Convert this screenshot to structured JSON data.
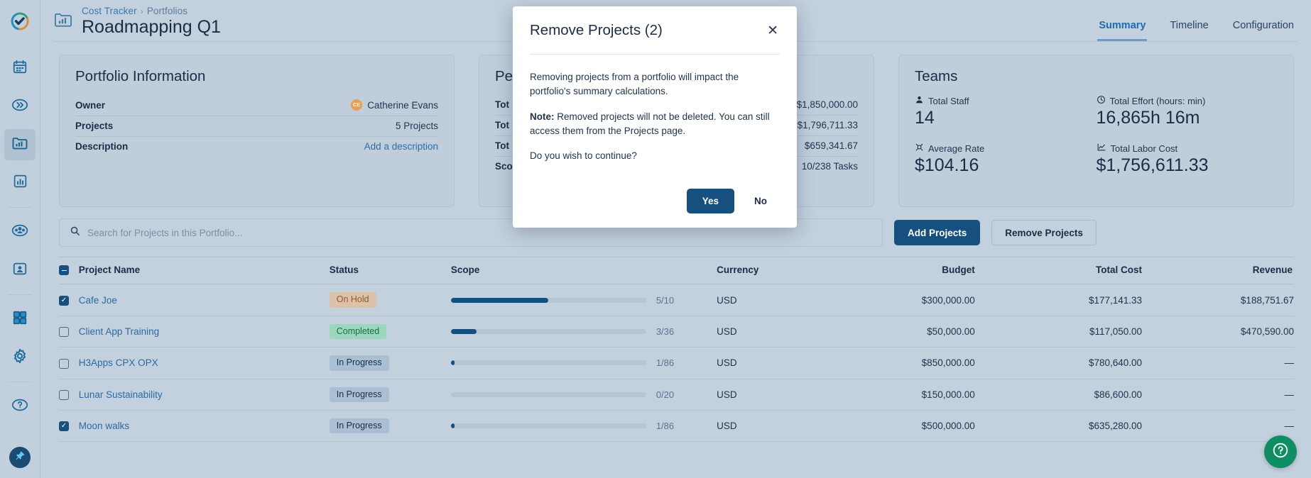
{
  "sidebar": {
    "items": [
      {
        "name": "app-logo-icon",
        "label": "Cost Tracker",
        "active": false
      },
      {
        "name": "calendar-icon",
        "label": "Calendar",
        "active": false
      },
      {
        "name": "chevron-double-right-icon",
        "label": "Timesheets",
        "active": false
      },
      {
        "name": "portfolio-folder-icon",
        "label": "Portfolios",
        "active": true
      },
      {
        "name": "bar-chart-icon",
        "label": "Reports",
        "active": false
      },
      {
        "name": "users-group-icon",
        "label": "Teams",
        "active": false
      },
      {
        "name": "user-card-icon",
        "label": "Staff",
        "active": false
      },
      {
        "name": "apps-grid-icon",
        "label": "Apps",
        "active": false
      },
      {
        "name": "gear-icon",
        "label": "Settings",
        "active": false
      },
      {
        "name": "help-circle-icon",
        "label": "Help",
        "active": false
      },
      {
        "name": "pin-icon",
        "label": "Pin Menu",
        "active": false
      }
    ]
  },
  "header": {
    "folder_icon": "portfolio-folder-icon",
    "breadcrumb": {
      "root": "Cost Tracker",
      "separator": "›",
      "current": "Portfolios"
    },
    "title": "Roadmapping Q1",
    "tabs": [
      {
        "label": "Summary",
        "active": true
      },
      {
        "label": "Timeline",
        "active": false
      },
      {
        "label": "Configuration",
        "active": false
      }
    ]
  },
  "cards": {
    "portfolio": {
      "title": "Portfolio Information",
      "rows": [
        {
          "key": "Owner",
          "value": "Catherine Evans",
          "avatar_initials": "CE",
          "link": false
        },
        {
          "key": "Projects",
          "value": "5 Projects",
          "link": false
        },
        {
          "key": "Description",
          "value": "Add a description",
          "link": true
        }
      ]
    },
    "performance": {
      "title": "Pe",
      "title_full": "Performance",
      "rows": [
        {
          "key": "Tot",
          "value": "$1,850,000.00"
        },
        {
          "key": "Tot",
          "value": "$1,796,711.33"
        },
        {
          "key": "Tot",
          "value": "$659,341.67"
        },
        {
          "key": "Sco",
          "value": "10/238 Tasks"
        }
      ]
    },
    "teams": {
      "title": "Teams",
      "metrics": [
        {
          "icon": "person-icon",
          "label": "Total Staff",
          "value": "14"
        },
        {
          "icon": "clock-icon",
          "label": "Total Effort (hours: min)",
          "value": "16,865h 16m"
        },
        {
          "icon": "rate-icon",
          "label": "Average Rate",
          "value": "$104.16"
        },
        {
          "icon": "trend-up-icon",
          "label": "Total Labor Cost",
          "value": "$1,756,611.33"
        }
      ]
    }
  },
  "toolbar": {
    "search_placeholder": "Search for Projects in this Portfolio...",
    "search_value": "",
    "search_icon": "search-icon",
    "add_projects_label": "Add Projects",
    "remove_projects_label": "Remove Projects"
  },
  "table": {
    "columns": [
      "Project Name",
      "Status",
      "Scope",
      "Currency",
      "Budget",
      "Total Cost",
      "Revenue"
    ],
    "select_all_state": "indeterminate",
    "rows": [
      {
        "selected": true,
        "name": "Cafe Joe",
        "status": "On Hold",
        "status_kind": "onhold",
        "scope_done": 5,
        "scope_total": 10,
        "scope_text": "5/10",
        "scope_pct": 50,
        "currency": "USD",
        "budget": "$300,000.00",
        "total_cost": "$177,141.33",
        "revenue": "$188,751.67"
      },
      {
        "selected": false,
        "name": "Client App Training",
        "status": "Completed",
        "status_kind": "completed",
        "scope_done": 3,
        "scope_total": 36,
        "scope_text": "3/36",
        "scope_pct": 13,
        "currency": "USD",
        "budget": "$50,000.00",
        "total_cost": "$117,050.00",
        "revenue": "$470,590.00"
      },
      {
        "selected": false,
        "name": "H3Apps CPX OPX",
        "status": "In Progress",
        "status_kind": "inprogress",
        "scope_done": 1,
        "scope_total": 86,
        "scope_text": "1/86",
        "scope_pct": 2,
        "currency": "USD",
        "budget": "$850,000.00",
        "total_cost": "$780,640.00",
        "revenue": "—"
      },
      {
        "selected": false,
        "name": "Lunar Sustainability",
        "status": "In Progress",
        "status_kind": "inprogress",
        "scope_done": 0,
        "scope_total": 20,
        "scope_text": "0/20",
        "scope_pct": 0,
        "currency": "USD",
        "budget": "$150,000.00",
        "total_cost": "$86,600.00",
        "revenue": "—"
      },
      {
        "selected": true,
        "name": "Moon walks",
        "status": "In Progress",
        "status_kind": "inprogress",
        "scope_done": 1,
        "scope_total": 86,
        "scope_text": "1/86",
        "scope_pct": 2,
        "currency": "USD",
        "budget": "$500,000.00",
        "total_cost": "$635,280.00",
        "revenue": "—"
      }
    ]
  },
  "modal": {
    "title": "Remove Projects (2)",
    "close_icon": "close-icon",
    "paragraph1": "Removing projects from a portfolio will impact the portfolio's summary calculations.",
    "note_label": "Note:",
    "note_text": " Removed projects will not be deleted. You can still access them from the Projects page.",
    "question": "Do you wish to continue?",
    "yes_label": "Yes",
    "no_label": "No"
  },
  "fab": {
    "icon": "help-circle-icon",
    "color": "#0e8f63"
  },
  "colors": {
    "page_bg": "#c3d0dd",
    "accent": "#17507e",
    "link": "#2a6ba6",
    "badge_onhold_bg": "#dcc2a8",
    "badge_completed_bg": "#9bd7bd",
    "badge_inprogress_bg": "#aabfd3",
    "avatar_bg": "#e3a156",
    "fab_green": "#0e8f63"
  }
}
